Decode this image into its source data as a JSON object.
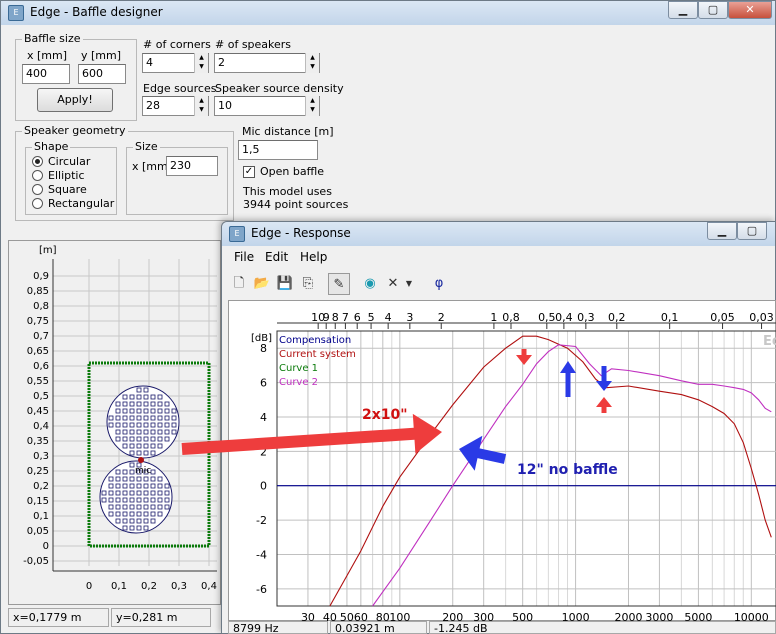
{
  "baffle_window": {
    "title": "Edge - Baffle designer",
    "baffle_size": {
      "group": "Baffle size",
      "x_label": "x [mm]",
      "y_label": "y [mm]",
      "x_value": "400",
      "y_value": "600",
      "apply_label": "Apply!"
    },
    "corners": {
      "label": "# of corners",
      "value": "4"
    },
    "speakers": {
      "label": "# of speakers",
      "value": "2"
    },
    "edge_sources": {
      "label": "Edge sources",
      "value": "28"
    },
    "source_density": {
      "label": "Speaker source density",
      "value": "10"
    },
    "speaker_geometry": {
      "group": "Speaker geometry",
      "shape_group": "Shape",
      "shapes": [
        "Circular",
        "Elliptic",
        "Square",
        "Rectangular"
      ],
      "selected_shape": "Circular",
      "size_group": "Size",
      "size_label": "x [mm]",
      "size_value": "230"
    },
    "mic_distance": {
      "label": "Mic distance [m]",
      "value": "1,5"
    },
    "open_baffle": {
      "label": "Open baffle",
      "checked": true
    },
    "model_info": [
      "This model uses",
      "3944 point sources"
    ],
    "plot": {
      "unit": "[m]",
      "y_ticks": [
        "0,9",
        "0,85",
        "0,8",
        "0,75",
        "0,7",
        "0,65",
        "0,6",
        "0,55",
        "0,5",
        "0,45",
        "0,4",
        "0,35",
        "0,3",
        "0,25",
        "0,2",
        "0,15",
        "0,1",
        "0,05",
        "0",
        "-0,05"
      ],
      "x_ticks": [
        "0",
        "0,1",
        "0,2",
        "0,3",
        "0,4"
      ],
      "mic_label": "mic",
      "baffle_color": "#0a7a0a",
      "speaker_color": "#1a1a6a"
    },
    "status": {
      "x": "x=0,1779 m",
      "y": "y=0,281 m"
    }
  },
  "response_window": {
    "title": "Edge - Response",
    "menu": [
      "File",
      "Edit",
      "Help"
    ],
    "toolbar_icons": [
      "new-icon",
      "open-icon",
      "save-icon",
      "copy-icon",
      "pen-icon",
      "speaker-icon",
      "delete-icon",
      "dropdown-icon",
      "phase-icon"
    ],
    "phase_symbol": "φ",
    "status": {
      "freq": "8799 Hz",
      "time": "0.03921 m",
      "level": "-1.245 dB"
    }
  },
  "chart_data": {
    "type": "line",
    "ylabel": "[dB]",
    "x_scale": "log",
    "x_range": [
      20,
      14000
    ],
    "y_range": [
      -7,
      9
    ],
    "x_ticks": [
      {
        "v": 30,
        "t": "30"
      },
      {
        "v": 40,
        "t": "40"
      },
      {
        "v": 50,
        "t": "50"
      },
      {
        "v": 60,
        "t": "60"
      },
      {
        "v": 80,
        "t": "80"
      },
      {
        "v": 100,
        "t": "100"
      },
      {
        "v": 200,
        "t": "200"
      },
      {
        "v": 300,
        "t": "300"
      },
      {
        "v": 500,
        "t": "500"
      },
      {
        "v": 1000,
        "t": "1000"
      },
      {
        "v": 2000,
        "t": "2000"
      },
      {
        "v": 3000,
        "t": "3000"
      },
      {
        "v": 5000,
        "t": "5000"
      },
      {
        "v": 10000,
        "t": "10000"
      }
    ],
    "minor_x": [
      20,
      70,
      90,
      400,
      600,
      700,
      800,
      900,
      4000,
      6000,
      7000,
      8000,
      9000
    ],
    "top_ticks": [
      {
        "f": 34.3,
        "t": "10"
      },
      {
        "f": 38.1,
        "t": "9"
      },
      {
        "f": 42.9,
        "t": "8"
      },
      {
        "f": 49,
        "t": "7"
      },
      {
        "f": 57.2,
        "t": "6"
      },
      {
        "f": 68.6,
        "t": "5"
      },
      {
        "f": 85.8,
        "t": "4"
      },
      {
        "f": 114,
        "t": "3"
      },
      {
        "f": 172,
        "t": "2"
      },
      {
        "f": 343,
        "t": "1"
      },
      {
        "f": 429,
        "t": "0,8"
      },
      {
        "f": 686,
        "t": "0,5"
      },
      {
        "f": 858,
        "t": "0,4"
      },
      {
        "f": 1144,
        "t": "0,3"
      },
      {
        "f": 1716,
        "t": "0,2"
      },
      {
        "f": 3430,
        "t": "0,1"
      },
      {
        "f": 6860,
        "t": "0,05"
      },
      {
        "f": 11433,
        "t": "0,03"
      }
    ],
    "y_ticks": [
      8,
      6,
      4,
      2,
      0,
      -2,
      -4,
      -6
    ],
    "legend": [
      "Compensation",
      "Current system",
      "Curve 1",
      "Curve 2"
    ],
    "watermark": "Edge",
    "series": [
      {
        "name": "Compensation",
        "color": "#00008b",
        "points": [
          [
            20,
            0
          ],
          [
            14000,
            0
          ]
        ]
      },
      {
        "name": "Current system",
        "color": "#b01010",
        "points": [
          [
            40,
            -7
          ],
          [
            60,
            -3.8
          ],
          [
            80,
            -1.2
          ],
          [
            100,
            0.5
          ],
          [
            150,
            3.0
          ],
          [
            200,
            4.7
          ],
          [
            300,
            6.9
          ],
          [
            400,
            8.0
          ],
          [
            500,
            8.7
          ],
          [
            600,
            8.7
          ],
          [
            700,
            8.5
          ],
          [
            900,
            8.0
          ],
          [
            1100,
            7.2
          ],
          [
            1300,
            6.2
          ],
          [
            1500,
            5.7
          ],
          [
            2000,
            5.8
          ],
          [
            3000,
            5.5
          ],
          [
            4000,
            5.3
          ],
          [
            5000,
            5.0
          ],
          [
            6000,
            4.6
          ],
          [
            7000,
            4.2
          ],
          [
            8000,
            3.6
          ],
          [
            9000,
            2.5
          ],
          [
            10000,
            1.0
          ],
          [
            11000,
            -0.5
          ],
          [
            12000,
            -2.0
          ],
          [
            13000,
            -3.0
          ]
        ]
      },
      {
        "name": "Curve 1",
        "color": "#0a7a0a",
        "points": []
      },
      {
        "name": "Curve 2",
        "color": "#c030c0",
        "points": [
          [
            70,
            -7
          ],
          [
            100,
            -4.8
          ],
          [
            150,
            -2.0
          ],
          [
            200,
            0
          ],
          [
            300,
            2.7
          ],
          [
            400,
            4.6
          ],
          [
            500,
            5.9
          ],
          [
            600,
            7.1
          ],
          [
            700,
            7.8
          ],
          [
            800,
            8.2
          ],
          [
            1000,
            8.1
          ],
          [
            1200,
            7.1
          ],
          [
            1400,
            6.4
          ],
          [
            1600,
            6.8
          ],
          [
            2000,
            6.7
          ],
          [
            3000,
            6.4
          ],
          [
            4000,
            6.1
          ],
          [
            5000,
            5.9
          ],
          [
            6000,
            5.9
          ],
          [
            7000,
            5.8
          ],
          [
            8000,
            5.7
          ],
          [
            9000,
            5.6
          ],
          [
            10000,
            5.4
          ],
          [
            11000,
            5.0
          ],
          [
            12000,
            4.5
          ],
          [
            13000,
            4.3
          ]
        ]
      }
    ],
    "annotations": [
      {
        "text": "2x10\"",
        "color": "#d01010"
      },
      {
        "text": "12\" no baffle",
        "color": "#2020b0"
      }
    ],
    "arrow_colors": {
      "red": "#ee3d3d",
      "blue": "#2a3ae6"
    }
  }
}
